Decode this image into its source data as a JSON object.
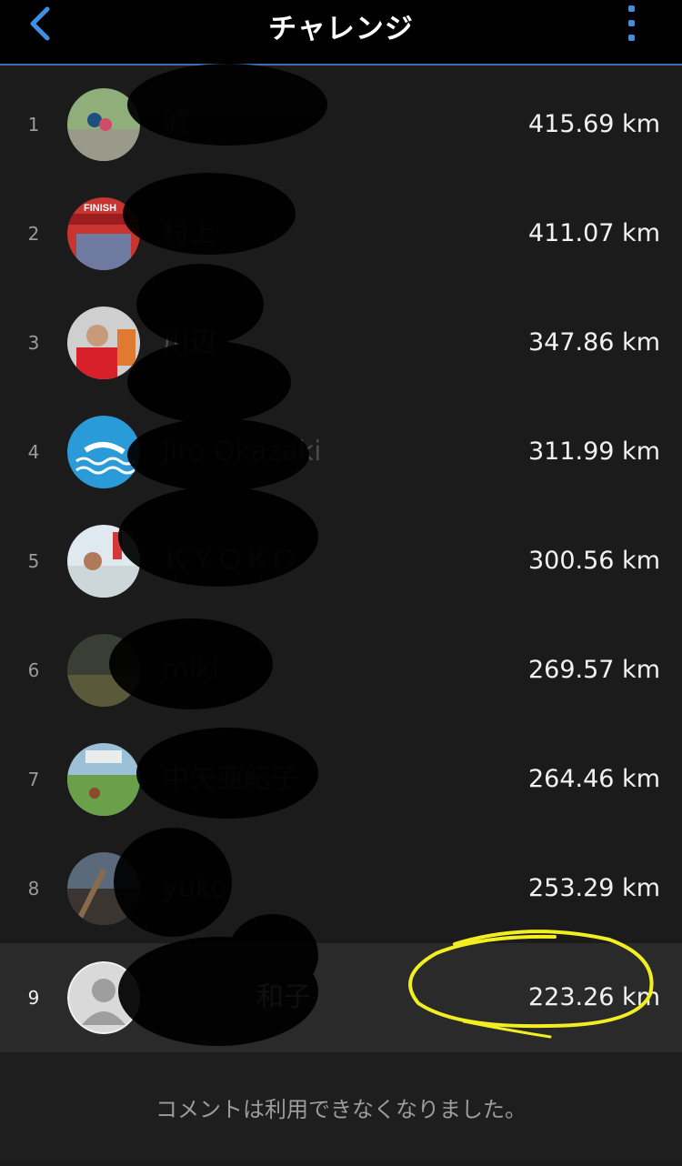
{
  "header": {
    "title": "チャレンジ",
    "back_icon": "chevron-left-icon",
    "menu_icon": "more-vertical-icon",
    "accent": "#3d8fe6"
  },
  "leaderboard": [
    {
      "rank": "1",
      "name": "城",
      "distance": "415.69 km"
    },
    {
      "rank": "2",
      "name": "村上",
      "distance": "411.07 km"
    },
    {
      "rank": "3",
      "name": "川辺",
      "distance": "347.86 km"
    },
    {
      "rank": "4",
      "name": "Jiro Okazaki",
      "distance": "311.99 km"
    },
    {
      "rank": "5",
      "name": "ＫＹＯＫＯ",
      "distance": "300.56 km"
    },
    {
      "rank": "6",
      "name": "miki",
      "distance": "269.57 km"
    },
    {
      "rank": "7",
      "name": "中矢亜紀子",
      "distance": "264.46 km"
    },
    {
      "rank": "8",
      "name": "yuko",
      "distance": "253.29 km"
    },
    {
      "rank": "9",
      "name": "和子",
      "distance": "223.26 km"
    }
  ],
  "footer": {
    "notice": "コメントは利用できなくなりました。"
  }
}
